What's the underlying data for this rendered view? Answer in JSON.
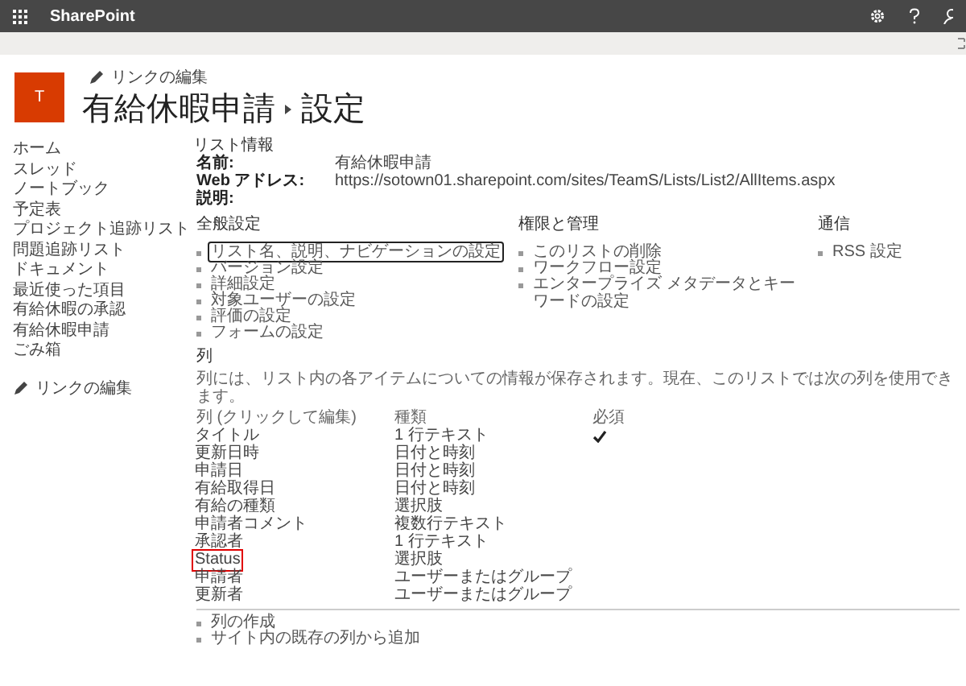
{
  "suite_bar": {
    "app_name": "SharePoint"
  },
  "header": {
    "logo_letter": "T",
    "edit_links": "リンクの編集",
    "site_title": "有給休暇申請",
    "page_title": "設定"
  },
  "sidebar": {
    "items": [
      "ホーム",
      "スレッド",
      "ノートブック",
      "予定表",
      "プロジェクト追跡リスト",
      "問題追跡リスト",
      "ドキュメント",
      "最近使った項目",
      "有給休暇の承認",
      "有給休暇申請",
      "ごみ箱"
    ],
    "edit_links": "リンクの編集"
  },
  "list_info": {
    "heading": "リスト情報",
    "fields": [
      {
        "label": "名前:",
        "value": "有給休暇申請"
      },
      {
        "label": "Web アドレス:",
        "value": "https://sotown01.sharepoint.com/sites/TeamS/Lists/List2/AllItems.aspx"
      },
      {
        "label": "説明:"
      }
    ]
  },
  "setting_groups": [
    {
      "heading": "全般設定",
      "links": [
        {
          "label": "リスト名、説明、ナビゲーションの設定",
          "highlighted": true
        },
        {
          "label": "バージョン設定",
          "highlighted": false
        },
        {
          "label": "詳細設定",
          "highlighted": false
        },
        {
          "label": "対象ユーザーの設定",
          "highlighted": false
        },
        {
          "label": "評価の設定",
          "highlighted": false
        },
        {
          "label": "フォームの設定",
          "highlighted": false
        }
      ]
    },
    {
      "heading": "権限と管理",
      "links": [
        {
          "label": "このリストの削除",
          "highlighted": false
        },
        {
          "label": "ワークフロー設定",
          "highlighted": false
        },
        {
          "label": "エンタープライズ メタデータとキーワードの設定",
          "highlighted": false
        }
      ]
    },
    {
      "heading": "通信",
      "links": [
        {
          "label": "RSS 設定",
          "highlighted": false
        }
      ]
    }
  ],
  "columns_section": {
    "heading": "列",
    "description": "列には、リスト内の各アイテムについての情報が保存されます。現在、このリストでは次の列を使用できます。",
    "headers": [
      "列 (クリックして編集)",
      "種類",
      "必須"
    ],
    "rows": [
      {
        "name": "タイトル",
        "type": "1 行テキスト",
        "required": true,
        "highlighted": false
      },
      {
        "name": "更新日時",
        "type": "日付と時刻",
        "required": false,
        "highlighted": false
      },
      {
        "name": "申請日",
        "type": "日付と時刻",
        "required": false,
        "highlighted": false
      },
      {
        "name": "有給取得日",
        "type": "日付と時刻",
        "required": false,
        "highlighted": false
      },
      {
        "name": "有給の種類",
        "type": "選択肢",
        "required": false,
        "highlighted": false
      },
      {
        "name": "申請者コメント",
        "type": "複数行テキスト",
        "required": false,
        "highlighted": false
      },
      {
        "name": "承認者",
        "type": "1 行テキスト",
        "required": false,
        "highlighted": false
      },
      {
        "name": "Status",
        "type": "選択肢",
        "required": false,
        "highlighted": true
      },
      {
        "name": "申請者",
        "type": "ユーザーまたはグループ",
        "required": false,
        "highlighted": false
      },
      {
        "name": "更新者",
        "type": "ユーザーまたはグループ",
        "required": false,
        "highlighted": false
      }
    ],
    "links": [
      "列の作成",
      "サイト内の既存の列から追加"
    ]
  }
}
